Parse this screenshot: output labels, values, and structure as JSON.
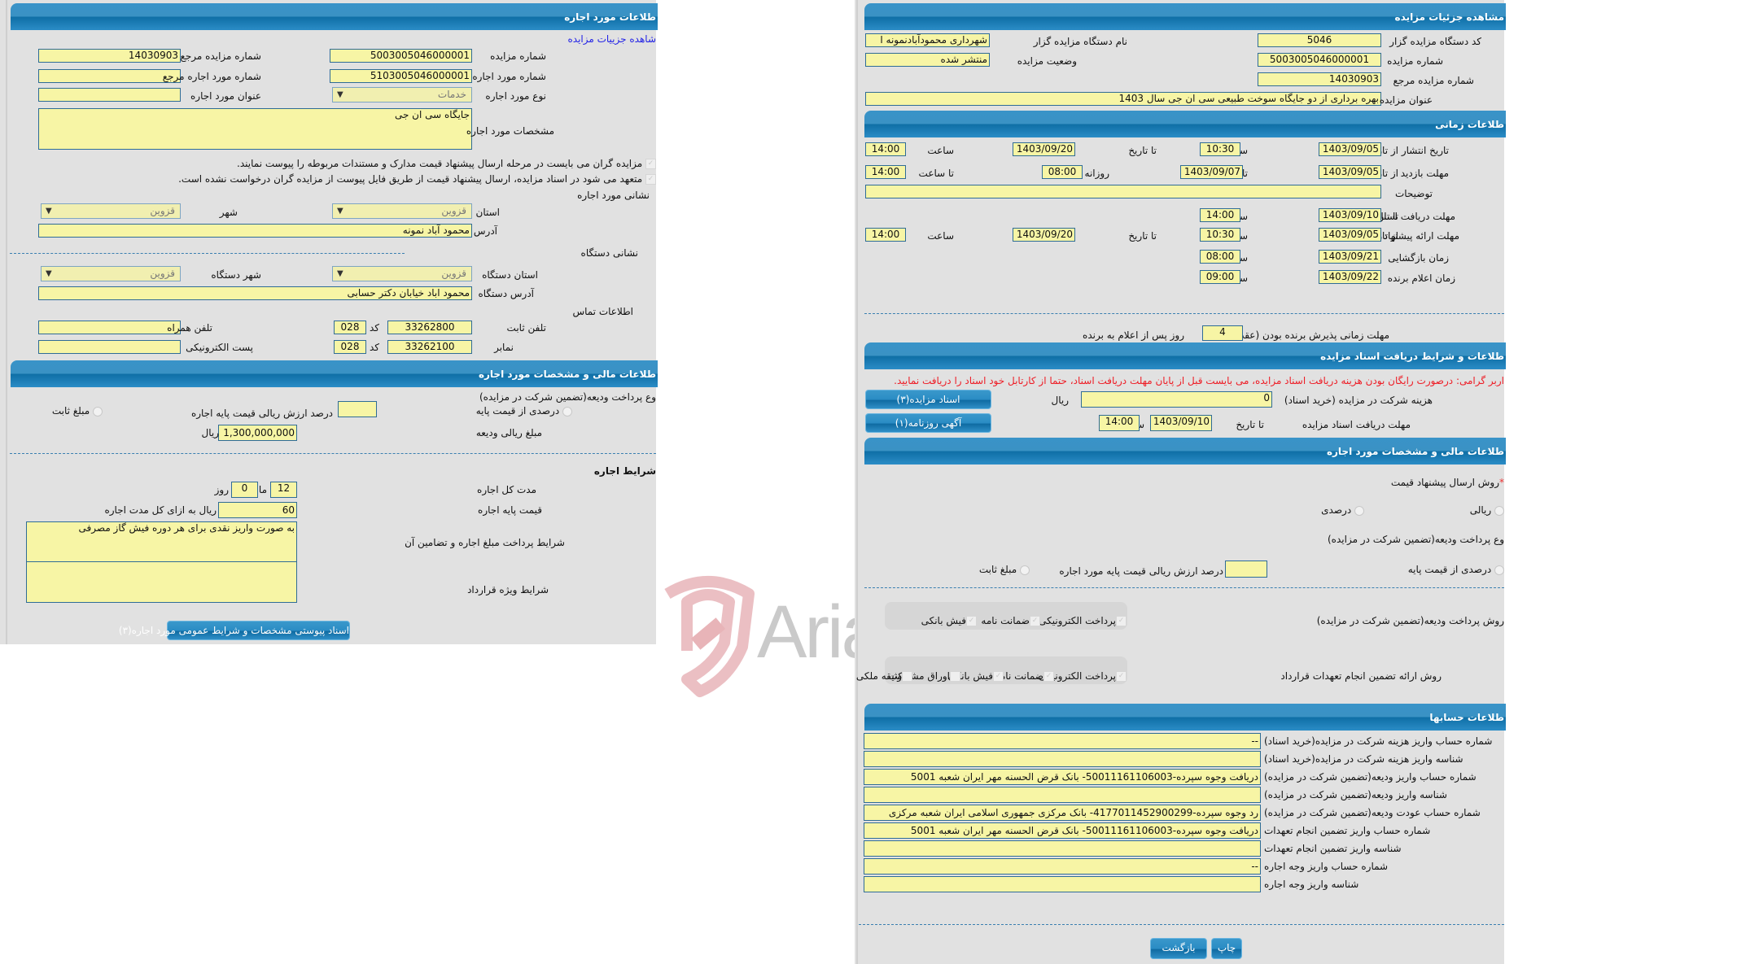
{
  "left_panel": {
    "header": "طلاعات مورد اجاره",
    "view_details_link": "شاهده جزییات مزایده",
    "fields": {
      "auction_number_label": "شماره مزایده",
      "auction_number": "5003005046000001",
      "ref_auction_number_label": "شماره مزایده مرجع",
      "ref_auction_number": "14030903",
      "lease_item_number_label": "شماره مورد اجاره",
      "lease_item_number": "5103005046000001",
      "ref_lease_item_number_label": "شماره مورد اجاره مرجع",
      "ref_lease_item_number": "",
      "lease_type_label": "نوع مورد اجاره",
      "lease_type": "خدمات",
      "lease_title_label": "عنوان مورد اجاره",
      "lease_title": "",
      "lease_specs_label": "مشخصات مورد اجاره",
      "lease_specs": "جایگاه سی ان جی"
    },
    "notes": [
      "مزایده گران می بایست در مرحله ارسال پیشنهاد قیمت مدارک و مستندات مربوطه را پیوست نمایند.",
      "متعهد می شود در اسناد مزایده، ارسال پیشنهاد قیمت از طریق فایل پیوست از مزایده گران درخواست نشده است."
    ],
    "lease_address": {
      "title": "نشانی مورد اجاره",
      "province_label": "استان",
      "province": "قزوین",
      "city_label": "شهر",
      "city": "قزوین",
      "address_label": "آدرس",
      "address": "محمود آباد نمونه"
    },
    "org_address": {
      "title": "نشانی دستگاه",
      "province_label": "استان دستگاه",
      "province": "قزوین",
      "city_label": "شهر دستگاه",
      "city": "قزوین",
      "address_label": "آدرس دستگاه",
      "address": "محمود اباد خیابان دکتر حسابی"
    },
    "contact": {
      "title": "اطلاعات تماس",
      "phone_label": "تلفن ثابت",
      "phone": "33262800",
      "code_label": "کد",
      "phone_code": "028",
      "mobile_label": "تلفن همراه",
      "mobile": "",
      "fax_label": "نمابر",
      "fax": "33262100",
      "fax_code": "028",
      "email_label": "پست الکترونیکی",
      "email": ""
    },
    "finance": {
      "header": "طلاعات مالی و مشخصات مورد اجاره",
      "deposit_type_label": "وع پرداخت ودیعه(تضمین شرکت در مزایده)",
      "percent_option": "درصدی از قیمت پایه",
      "percent_desc": "درصد ارزش ریالی قیمت پایه اجاره",
      "percent_value": "",
      "fixed_option": "مبلغ ثابت",
      "deposit_amount_label": "مبلغ ریالی ودیعه",
      "deposit_amount": "1,300,000,000",
      "rial": "ریال"
    },
    "terms": {
      "title": "شرایط اجاره",
      "duration_label": "مدت کل اجاره",
      "months": "12",
      "month_label": "ماه",
      "days": "0",
      "day_label": "روز",
      "base_price_label": "قیمت پایه اجاره",
      "base_price": "60",
      "base_price_unit": "ریال به ازای کل مدت اجاره",
      "payment_terms_label": "شرایط پرداخت مبلغ اجاره و تضامین آن",
      "payment_terms": "به صورت واریز نقدی برای هر دوره فیش گاز مصرفی",
      "special_terms_label": "شرایط ویژه قرارداد",
      "special_terms": ""
    },
    "attachments_button": "اسناد پیوستی مشخصات و شرایط عمومی مورد اجاره(۳)"
  },
  "right_panel": {
    "header": "مشاهده جزئیات مزایده",
    "org_code_label": "کد دستگاه مزایده گزار",
    "org_code": "5046",
    "org_name_label": "نام دستگاه مزایده گزار",
    "org_name": "شهرداری محمودآبادنمونه ا",
    "auction_number_label": "شماره مزایده",
    "auction_number": "5003005046000001",
    "status_label": "وضعیت مزایده",
    "status": "منتشر شده",
    "ref_number_label": "شماره مزایده مرجع",
    "ref_number": "14030903",
    "title_label": "عنوان مزایده",
    "title": "بهره برداری از دو جایگاه سوخت طبیعی سی ان جی سال 1403",
    "time": {
      "header": "طلاعات زمانی",
      "publish_label": "تاریخ انتشار",
      "from_date_label": "از تاریخ",
      "to_date_label": "تا تاریخ",
      "date_label": "تاریخ",
      "time_label": "ساعت",
      "daily_from_label": "روزانه از ساعت",
      "to_time_label": "تا ساعت",
      "publish_from": "1403/09/05",
      "publish_from_time": "10:30",
      "publish_to": "1403/09/20",
      "publish_to_time": "14:00",
      "visit_label": "مهلت بازدید",
      "visit_from": "1403/09/05",
      "visit_to": "1403/09/07",
      "visit_daily_from": "08:00",
      "visit_daily_to": "14:00",
      "desc_label": "توضیحات",
      "desc": "",
      "doc_deadline_label": "مهلت دریافت اسناد",
      "doc_deadline_date": "1403/09/10",
      "doc_deadline_time": "14:00",
      "offer_label": "مهلت ارائه پیشنهاد",
      "offer_from": "1403/09/05",
      "offer_from_time": "10:30",
      "offer_to": "1403/09/20",
      "offer_to_time": "14:00",
      "opening_label": "زمان بازگشایی",
      "opening_date": "1403/09/21",
      "opening_time": "08:00",
      "winner_label": "زمان اعلام برنده",
      "winner_date": "1403/09/22",
      "winner_time": "09:00",
      "acceptance_label": "مهلت زمانی پذیرش برنده بودن (عقد قرارداد)",
      "acceptance_days": "4",
      "acceptance_suffix": "روز پس از اعلام به برنده"
    },
    "docs": {
      "header": "طلاعات و شرایط دریافت اسناد مزایده",
      "note": "اربر گرامی: درصورت رایگان بودن هزینه دریافت اسناد مزایده، می بایست قبل از پایان مهلت دریافت اسناد، حتما از کارتابل خود اسناد را دریافت نمایید.",
      "fee_label": "هزینه شرکت در مزایده (خرید اسناد)",
      "fee": "0",
      "rial": "ریال",
      "deadline_label": "مهلت دریافت اسناد مزایده",
      "to_date_label": "تا تاریخ",
      "deadline_date": "1403/09/10",
      "time_label": "ساعت",
      "deadline_time": "14:00",
      "docs_button": "اسناد مزایده(۳)",
      "newspaper_button": "آگهی روزنامه(۱)"
    },
    "finance": {
      "header": "طلاعات مالی و مشخصات مورد اجاره",
      "offer_method_label": "روش ارسال پیشنهاد قیمت",
      "rial_option": "ریالی",
      "percent_option": "درصدی",
      "deposit_type_label": "وع پرداخت ودیعه(تضمین شرکت در مزایده)",
      "percent_base_option": "درصدی از قیمت پایه",
      "percent_desc": "درصد ارزش ریالی قیمت پایه مورد اجاره",
      "percent_value": "",
      "fixed_option": "مبلغ ثابت",
      "deposit_method_label": "روش پرداخت ودیعه(تضمین شرکت در مزایده)",
      "deposit_methods": [
        {
          "label": "پرداخت الکترونیکی",
          "checked": true
        },
        {
          "label": "ضمانت نامه",
          "checked": true
        },
        {
          "label": "فیش بانکی",
          "checked": true
        }
      ],
      "guarantee_method_label": "روش ارائه تضمین انجام تعهدات قرارداد",
      "guarantee_methods": [
        {
          "label": "پرداخت الکترونیکی",
          "checked": true
        },
        {
          "label": "ضمانت نامه",
          "checked": true
        },
        {
          "label": "فیش بانکی",
          "checked": true
        },
        {
          "label": "اوراق مشارکت",
          "checked": false
        },
        {
          "label": "وثیقه ملکی",
          "checked": false
        }
      ]
    },
    "accounts": {
      "header": "طلاعات حسابها",
      "rows": [
        {
          "label": "شماره حساب واریز هزینه شرکت در مزایده(خرید اسناد)",
          "value": "--"
        },
        {
          "label": "شناسه واریز هزینه شرکت در مزایده(خرید اسناد)",
          "value": ""
        },
        {
          "label": "شماره حساب واریز ودیعه(تضمین شرکت در مزایده)",
          "value": "دریافت وجوه سپرده-50011161106003- بانک قرض الحسنه مهر ایران شعبه 5001"
        },
        {
          "label": "شناسه واریز ودیعه(تضمین شرکت در مزایده)",
          "value": ""
        },
        {
          "label": "شماره حساب عودت ودیعه(تضمین شرکت در مزایده)",
          "value": "رد وجوه سپرده-4177011452900299- بانک مرکزی جمهوری اسلامی ایران شعبه مرکزی"
        },
        {
          "label": "شماره حساب واریز تضمین انجام تعهدات",
          "value": "دریافت وجوه سپرده-50011161106003- بانک قرض الحسنه مهر ایران شعبه 5001"
        },
        {
          "label": "شناسه واریز تضمین انجام تعهدات",
          "value": ""
        },
        {
          "label": "شماره حساب واریز وجه اجاره",
          "value": "--"
        },
        {
          "label": "شناسه واریز وجه اجاره",
          "value": ""
        }
      ]
    },
    "print_button": "چاپ",
    "back_button": "بازگشت"
  },
  "watermark": {
    "text": "AriaTender.neT",
    "logo_color": "#e8b4b8",
    "text_color": "#b8b8b8"
  }
}
